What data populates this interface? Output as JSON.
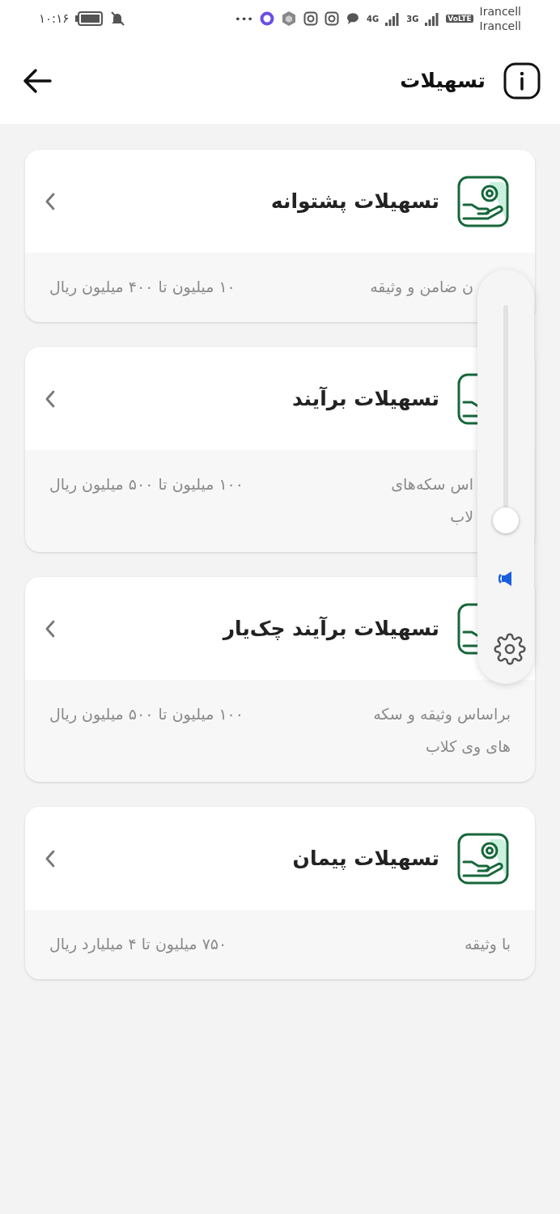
{
  "status_bar": {
    "time": "۱۰:۱۶",
    "more": "•••",
    "network_1": "4G",
    "network_2": "3G",
    "volte": "VoLTE",
    "carrier_1": "Irancell",
    "carrier_2": "Irancell"
  },
  "header": {
    "title": "تسهیلات"
  },
  "cards": [
    {
      "title": "تسهیلات پشتوانه",
      "description": "ن ضامن و وثیقه",
      "range": "۱۰ میلیون تا ۴۰۰ میلیون ریال",
      "covered": true
    },
    {
      "title": "تسهیلات برآیند",
      "description": "اس سکه‌های\nلاب",
      "range": "۱۰۰ میلیون تا ۵۰۰ میلیون ریال",
      "covered": true
    },
    {
      "title": "تسهیلات برآیند چک‌یار",
      "description": "براساس وثیقه و سکه\nهای وی کلاب",
      "range": "۱۰۰ میلیون تا ۵۰۰ میلیون ریال",
      "covered": false
    },
    {
      "title": "تسهیلات پیمان",
      "description": "با وثیقه",
      "range": "۷۵۰ میلیون تا ۴ میلیارد ریال",
      "covered": false
    }
  ],
  "volume_panel": {
    "level": 0.05
  }
}
